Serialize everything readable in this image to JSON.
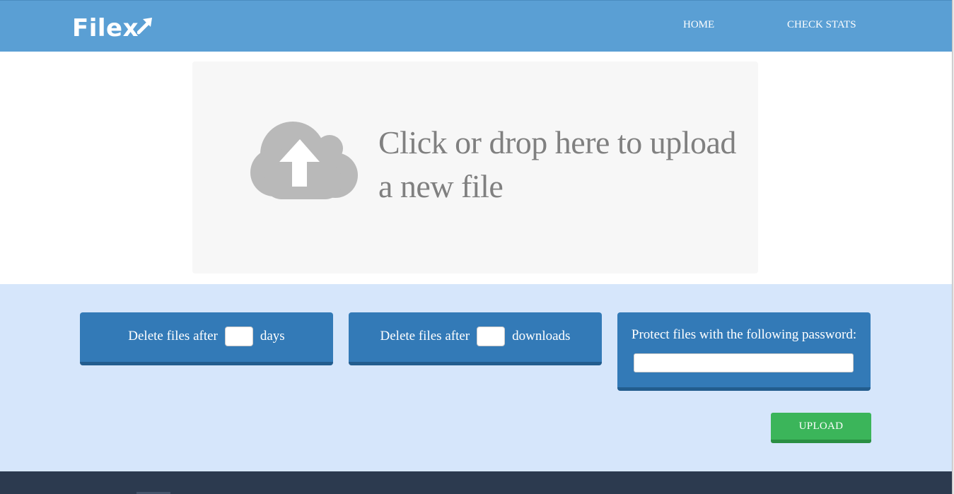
{
  "header": {
    "logo_text": "Filex",
    "nav": {
      "home": "HOME",
      "check_stats": "CHECK STATS"
    }
  },
  "upload_zone": {
    "icon": "cloud-upload-icon",
    "text": "Click or drop here to upload a new file"
  },
  "options": {
    "days": {
      "prefix": "Delete files after",
      "suffix": "days",
      "value": ""
    },
    "downloads": {
      "prefix": "Delete files after",
      "suffix": "downloads",
      "value": ""
    },
    "password": {
      "label": "Protect files with the following password:",
      "value": ""
    }
  },
  "upload_button": {
    "label": "UPLOAD"
  },
  "colors": {
    "header": "#5a9fd4",
    "option_box": "#337ab7",
    "options_background": "#d6e6fb",
    "upload_button": "#3bb55a",
    "footer": "#2c3a4f"
  }
}
